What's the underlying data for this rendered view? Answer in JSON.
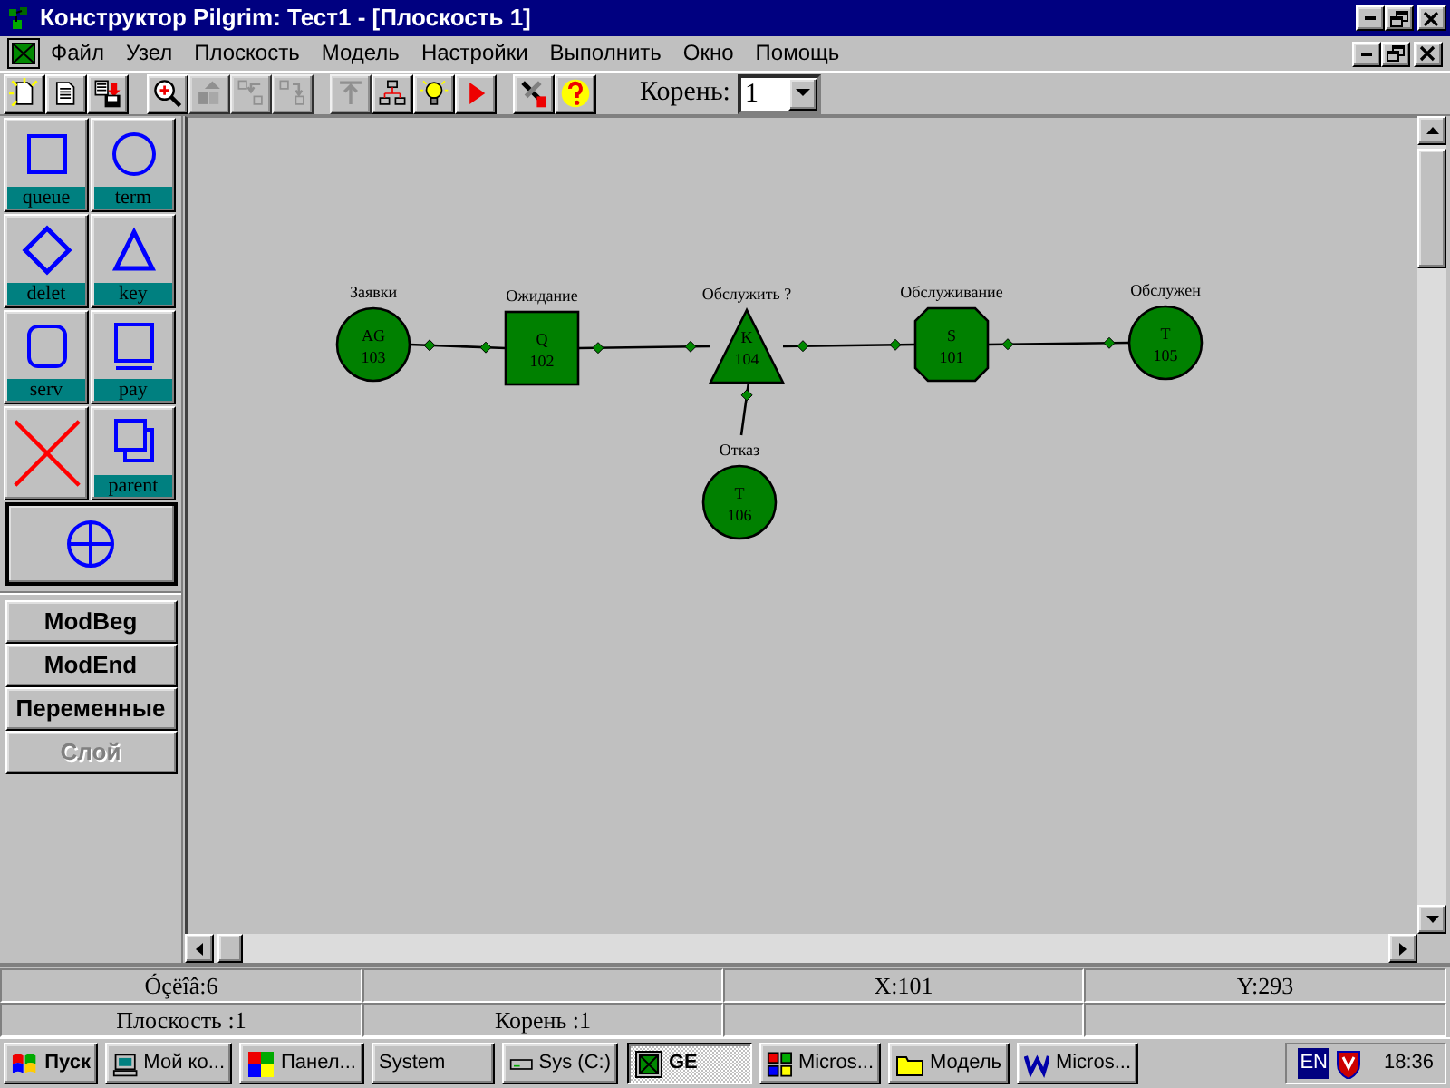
{
  "window": {
    "title": "Конструктор Pilgrim: Тест1 - [Плоскость 1]"
  },
  "menu": [
    "Файл",
    "Узел",
    "Плоскость",
    "Модель",
    "Настройки",
    "Выполнить",
    "Окно",
    "Помощь"
  ],
  "toolbar": {
    "groups": [
      [
        {
          "kind": "new",
          "disabled": false
        },
        {
          "kind": "document",
          "disabled": false
        },
        {
          "kind": "save",
          "disabled": false
        }
      ],
      [
        {
          "kind": "zoom",
          "disabled": false
        },
        {
          "kind": "move-up",
          "disabled": true
        },
        {
          "kind": "swap-left",
          "disabled": true
        },
        {
          "kind": "swap-right",
          "disabled": true
        }
      ],
      [
        {
          "kind": "top",
          "disabled": true
        },
        {
          "kind": "tree",
          "disabled": false
        },
        {
          "kind": "bulb",
          "disabled": false
        },
        {
          "kind": "run",
          "disabled": false
        }
      ],
      [
        {
          "kind": "tools",
          "disabled": false
        },
        {
          "kind": "help",
          "disabled": false
        }
      ]
    ],
    "root_label": "Корень:",
    "root_value": "1"
  },
  "palette": {
    "tools": [
      {
        "kind": "square",
        "label": "queue"
      },
      {
        "kind": "circle",
        "label": "term"
      },
      {
        "kind": "diamond",
        "label": "delet"
      },
      {
        "kind": "triangle",
        "label": "key"
      },
      {
        "kind": "rounded",
        "label": "serv"
      },
      {
        "kind": "tray",
        "label": "pay"
      },
      {
        "kind": "cross"
      },
      {
        "kind": "stack",
        "label": "parent"
      }
    ],
    "pointer_selected": true,
    "buttons": [
      {
        "label": "ModBeg",
        "disabled": false
      },
      {
        "label": "ModEnd",
        "disabled": false
      },
      {
        "label": "Переменные",
        "disabled": false
      },
      {
        "label": "Слой",
        "disabled": true
      }
    ]
  },
  "diagram": {
    "nodes": [
      {
        "kind": "circle",
        "label": "Заявки",
        "code": "AG",
        "number": "103"
      },
      {
        "kind": "square",
        "label": "Ожидание",
        "code": "Q",
        "number": "102"
      },
      {
        "kind": "triangle",
        "label": "Обслужить ?",
        "code": "K",
        "number": "104"
      },
      {
        "kind": "octagon",
        "label": "Обслуживание",
        "code": "S",
        "number": "101"
      },
      {
        "kind": "circle",
        "label": "Обслужен",
        "code": "T",
        "number": "105"
      },
      {
        "kind": "circle",
        "label": "Отказ",
        "code": "T",
        "number": "106"
      }
    ]
  },
  "status_bar": {
    "node_count": "Óçëîâ:6",
    "x": "X:101",
    "y": "Y:293",
    "plane": "Плоскость :1",
    "root": "Корень :1"
  },
  "taskbar": {
    "start": "Пуск",
    "tasks": [
      {
        "kind": "computer",
        "label": "Мой ко...",
        "selected": false
      },
      {
        "kind": "control-panel",
        "label": "Панел...",
        "selected": false
      },
      {
        "kind": "none",
        "label": "System",
        "selected": false
      },
      {
        "kind": "drive",
        "label": "Sys (C:)",
        "selected": false
      },
      {
        "kind": "app",
        "label": "GE",
        "selected": true
      },
      {
        "kind": "tiles",
        "label": "Micros...",
        "selected": false
      },
      {
        "kind": "folder",
        "label": "Модель",
        "selected": false
      },
      {
        "kind": "word",
        "label": "Micros...",
        "selected": false
      }
    ],
    "language": "EN",
    "clock": "18:36"
  }
}
